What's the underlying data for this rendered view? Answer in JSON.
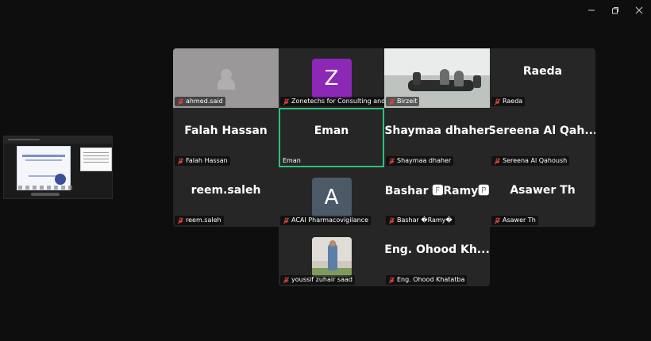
{
  "window": {
    "minimize_icon": "minimize-icon",
    "restore_icon": "restore-icon",
    "close_icon": "close-icon"
  },
  "participants": [
    {
      "label": "ahmed.said",
      "muted": true,
      "display": "video-blurred"
    },
    {
      "label": "Zonetechs for Consulting and ...",
      "muted": true,
      "display": "avatar",
      "initial": "Z",
      "avatar_color": "#8d27b5"
    },
    {
      "label": "Birzeit",
      "muted": true,
      "display": "video-room"
    },
    {
      "label": "Raeda",
      "muted": true,
      "display": "name",
      "name": "Raeda"
    },
    {
      "label": "Falah Hassan",
      "muted": true,
      "display": "name",
      "name": "Falah Hassan"
    },
    {
      "label": "Eman",
      "muted": false,
      "display": "name",
      "name": "Eman",
      "active_speaker": true
    },
    {
      "label": "Shaymaa dhaher",
      "muted": true,
      "display": "name",
      "name": "Shaymaa dhaher"
    },
    {
      "label": "Sereena Al Qahoush",
      "muted": true,
      "display": "name",
      "name": "Sereena  Al  Qah..."
    },
    {
      "label": "reem.saleh",
      "muted": true,
      "display": "name",
      "name": "reem.saleh"
    },
    {
      "label": "ACAI Pharmacovigilance",
      "muted": true,
      "display": "avatar",
      "initial": "A",
      "avatar_color": "#4b5a66"
    },
    {
      "label": "Bashar �Ramy�",
      "muted": true,
      "display": "name",
      "name": "Bashar 🅵Ramy🅿"
    },
    {
      "label": "Asawer Th",
      "muted": true,
      "display": "name",
      "name": "Asawer Th"
    },
    {
      "label": "youssif zuhair saad",
      "muted": true,
      "display": "photo"
    },
    {
      "label": "Eng. Ohood Khatatba",
      "muted": true,
      "display": "name",
      "name": "Eng.  Ohood  Kh..."
    }
  ],
  "colors": {
    "active_speaker": "#2fbf7e",
    "muted_icon": "#e0453a",
    "tile_bg": "#262626"
  }
}
